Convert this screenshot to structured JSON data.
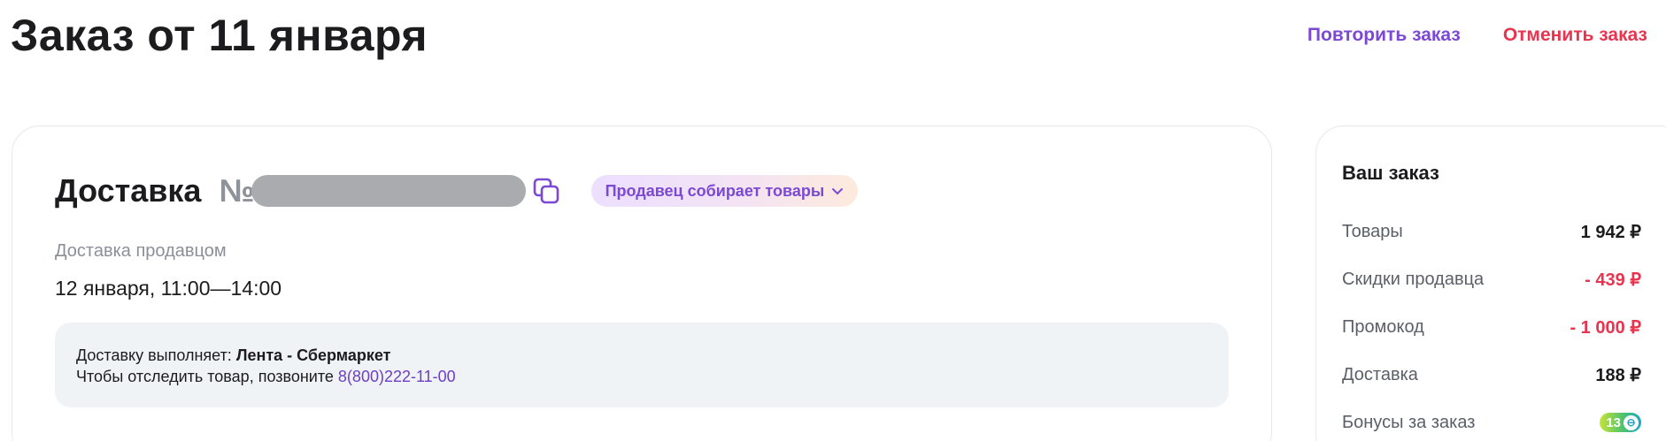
{
  "header": {
    "title": "Заказ от 11 января",
    "repeat_label": "Повторить заказ",
    "cancel_label": "Отменить заказ"
  },
  "delivery": {
    "title": "Доставка",
    "number_prefix": "№",
    "status": "Продавец собирает товары",
    "type": "Доставка продавцом",
    "time": "12 января, 11:00—14:00",
    "info": {
      "performer_label": "Доставку выполняет: ",
      "performer_name": "Лента - Сбермаркет",
      "track_text": "Чтобы отследить товар, позвоните ",
      "phone": "8(800)222-11-00"
    }
  },
  "summary": {
    "title": "Ваш заказ",
    "rows": [
      {
        "label": "Товары",
        "value": "1 942 ₽"
      },
      {
        "label": "Скидки продавца",
        "value": "- 439 ₽"
      },
      {
        "label": "Промокод",
        "value": "- 1 000 ₽"
      },
      {
        "label": "Доставка",
        "value": "188 ₽"
      },
      {
        "label": "Бонусы за заказ",
        "value": "13"
      }
    ]
  },
  "icons": {
    "copy": "copy-icon",
    "chevron": "chevron-down-icon",
    "bonus": "bonus-coin-icon"
  },
  "colors": {
    "accent": "#7b49d4",
    "danger": "#e8344e",
    "muted": "#8a8f98",
    "info_bg": "#f0f3f6"
  }
}
